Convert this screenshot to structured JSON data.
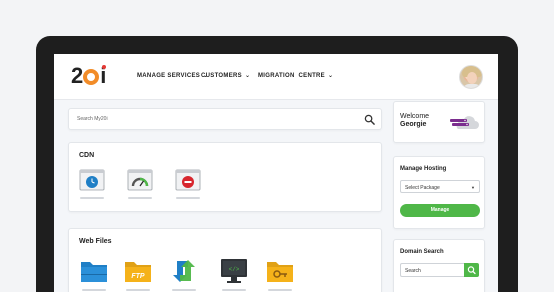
{
  "app": {
    "logo_text": "20i"
  },
  "nav": {
    "items": [
      {
        "label": "MANAGE SERVICES",
        "icon": "chevron-down-icon"
      },
      {
        "label": "CUSTOMERS",
        "icon": "chevron-down-icon"
      },
      {
        "label": "MIGRATION  CENTRE",
        "icon": "chevron-down-icon"
      }
    ]
  },
  "search": {
    "placeholder": "Search My20i",
    "icon": "search-icon"
  },
  "cdn": {
    "title": "CDN",
    "icons": [
      "clock-icon",
      "speedometer-icon",
      "block-icon"
    ]
  },
  "webfiles": {
    "title": "Web Files",
    "icons": [
      "folder-icon",
      "ftp-folder-icon",
      "sync-icon",
      "code-editor-icon",
      "key-folder-icon"
    ]
  },
  "welcome": {
    "label": "Welcome",
    "name": "Georgie",
    "icon": "cloud-server-icon"
  },
  "hosting": {
    "title": "Manage Hosting",
    "select_value": "Select Package",
    "button_label": "Manage"
  },
  "domain": {
    "title": "Domain Search",
    "placeholder": "Search",
    "icon": "search-icon"
  },
  "colors": {
    "accent_green": "#4fb748",
    "logo_orange": "#f28c28",
    "folder_blue": "#1f7fc6",
    "folder_yellow": "#f5b21a"
  }
}
